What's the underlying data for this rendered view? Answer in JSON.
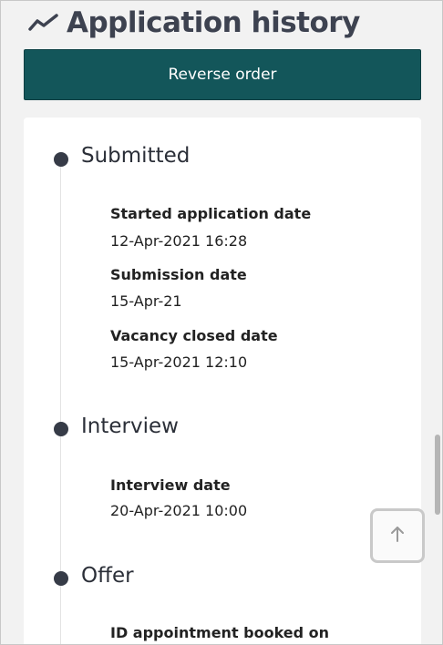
{
  "header": {
    "title": "Application history",
    "icon": "trend-line-icon"
  },
  "reverse_button": {
    "label": "Reverse order"
  },
  "timeline": [
    {
      "stage": "Submitted",
      "fields": [
        {
          "label": "Started application date",
          "value": "12-Apr-2021 16:28"
        },
        {
          "label": "Submission date",
          "value": "15-Apr-21"
        },
        {
          "label": "Vacancy closed date",
          "value": "15-Apr-2021 12:10"
        }
      ]
    },
    {
      "stage": "Interview",
      "fields": [
        {
          "label": "Interview date",
          "value": "20-Apr-2021 10:00"
        }
      ]
    },
    {
      "stage": "Offer",
      "fields": [
        {
          "label": "ID appointment booked on",
          "value": ""
        }
      ]
    }
  ],
  "back_to_top": {
    "icon": "arrow-up-icon"
  },
  "colors": {
    "accent": "#13565a",
    "dot": "#363b47",
    "heading": "#3d4250"
  }
}
